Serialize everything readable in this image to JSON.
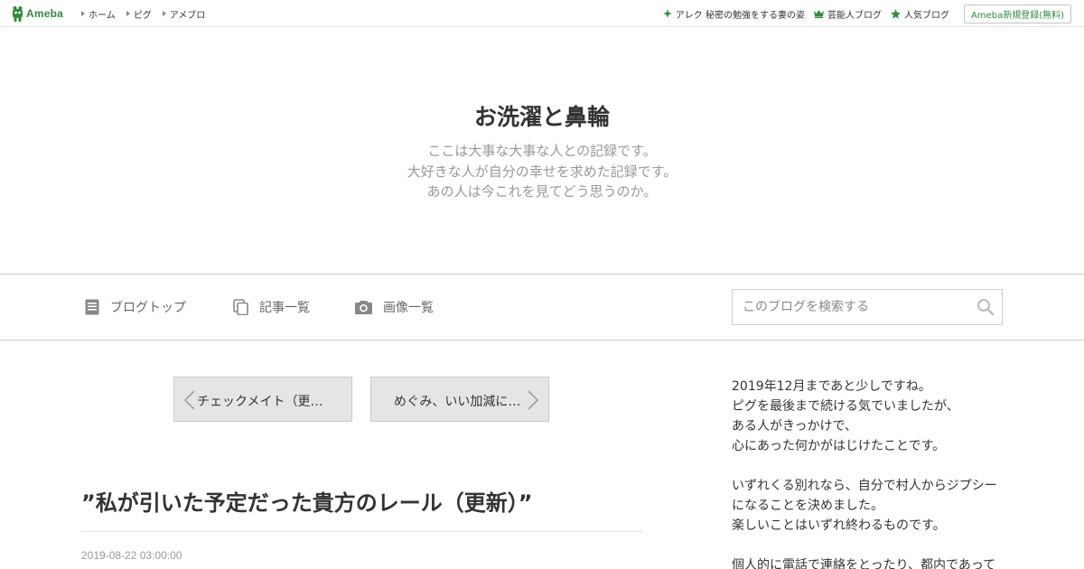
{
  "topbar": {
    "logo_text": "Ameba",
    "nav_left": [
      {
        "label": "ホーム"
      },
      {
        "label": "ピグ"
      },
      {
        "label": "アメブロ"
      }
    ],
    "nav_right": [
      {
        "icon": "sparkle-icon",
        "label": "アレク 秘密の勉強をする妻の姿"
      },
      {
        "icon": "crown-icon",
        "label": "芸能人ブログ"
      },
      {
        "icon": "star-icon",
        "label": "人気ブログ"
      }
    ],
    "register_label": "Ameba新規登録(無料)"
  },
  "header": {
    "title": "お洗濯と鼻輪",
    "description": [
      "ここは大事な大事な人との記録です。",
      "大好きな人が自分の幸せを求めた記録です。",
      "あの人は今これを見てどう思うのか。"
    ]
  },
  "menu": {
    "items": [
      {
        "icon": "document-icon",
        "label": "ブログトップ"
      },
      {
        "icon": "copy-icon",
        "label": "記事一覧"
      },
      {
        "icon": "camera-icon",
        "label": "画像一覧"
      }
    ],
    "search_placeholder": "このブログを検索する"
  },
  "pager": {
    "prev_label": "チェックメイト（更…",
    "next_label": "めぐみ、いい加減に…"
  },
  "article": {
    "title": "”私が引いた予定だった貴方のレール（更新）”",
    "date": "2019-08-22 03:00:00"
  },
  "sidebar": {
    "lines": [
      "2019年12月まであと少しですね。",
      "ピグを最後まで続ける気でいましたが、",
      "ある人がきっかけで、",
      "心にあった何かがはじけたことです。",
      "",
      "いずれくる別れなら、自分で村人からジプシー",
      "になることを決めました。",
      "楽しいことはいずれ終わるものです。",
      "",
      "個人的に電話で連絡をとったり、都内であって"
    ]
  },
  "colors": {
    "brand_green": "#2d8c3c",
    "text": "#333333",
    "muted": "#999999",
    "pager_bg": "#e5e5e5"
  }
}
